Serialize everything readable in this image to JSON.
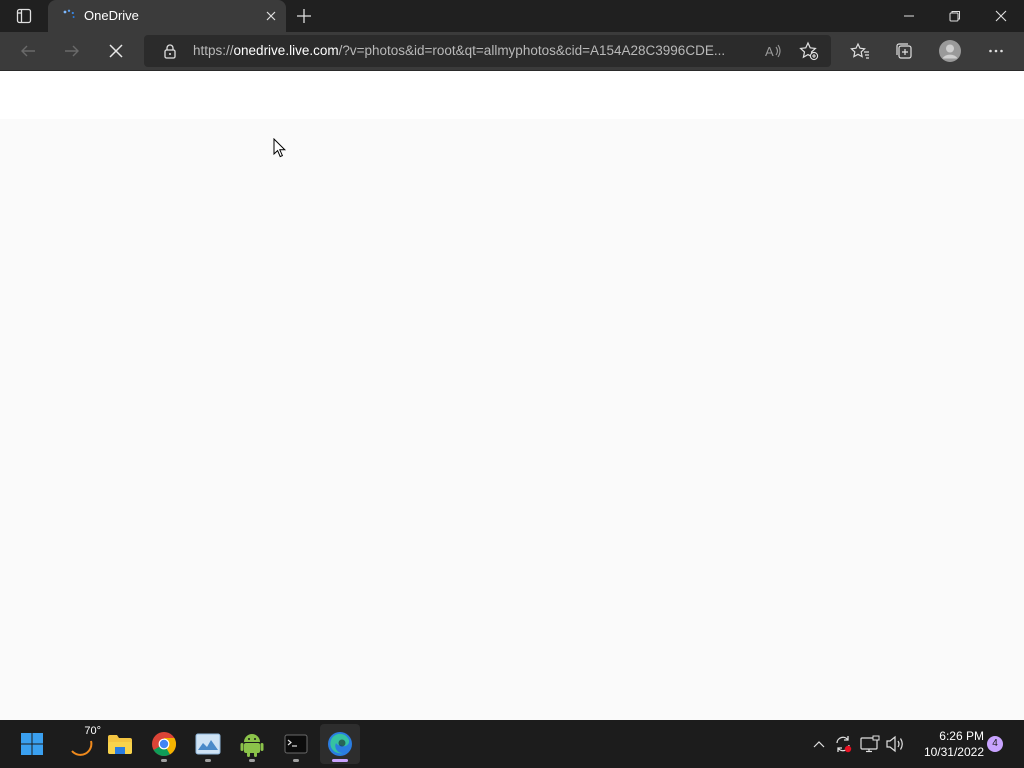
{
  "browser": {
    "tab": {
      "title": "OneDrive"
    },
    "address": {
      "url_prefix": "https://",
      "url_host": "onedrive.live.com",
      "url_rest": "/?v=photos&id=root&qt=allmyphotos&cid=A154A28C3996CDE..."
    }
  },
  "icons": {
    "tab_actions": "tab-actions-icon",
    "loading": "loading-spinner-icon",
    "tab_close": "close-icon",
    "new_tab": "plus-icon",
    "minimize": "minimize-icon",
    "restore": "restore-icon",
    "close_window": "close-icon",
    "back": "back-arrow-icon",
    "forward": "forward-arrow-icon",
    "stop": "stop-loading-icon",
    "lock": "lock-icon",
    "read_aloud": "read-aloud-icon",
    "add_favorite": "add-favorite-icon",
    "favorites": "favorites-icon",
    "collections": "collections-icon",
    "profile": "profile-icon",
    "more": "more-icon"
  },
  "taskbar": {
    "weather_temp": "70°",
    "apps": [
      {
        "name": "start",
        "icon": "windows-logo-icon"
      },
      {
        "name": "weather",
        "icon": "weather-icon"
      },
      {
        "name": "file-explorer",
        "icon": "folder-icon"
      },
      {
        "name": "chrome",
        "icon": "chrome-icon"
      },
      {
        "name": "photo-viewer",
        "icon": "image-icon"
      },
      {
        "name": "android-studio",
        "icon": "android-icon"
      },
      {
        "name": "terminal",
        "icon": "terminal-icon"
      },
      {
        "name": "edge",
        "icon": "edge-icon"
      }
    ],
    "clock": {
      "time": "6:26 PM",
      "date": "10/31/2022"
    },
    "notification_count": "4"
  },
  "colors": {
    "titlebar": "#202020",
    "toolbar": "#3b3b3b",
    "page_background": "#fafafa",
    "taskbar": "#1c1c1c",
    "accent": "#c8a3ff",
    "edge_blue": "#2a7de1"
  }
}
